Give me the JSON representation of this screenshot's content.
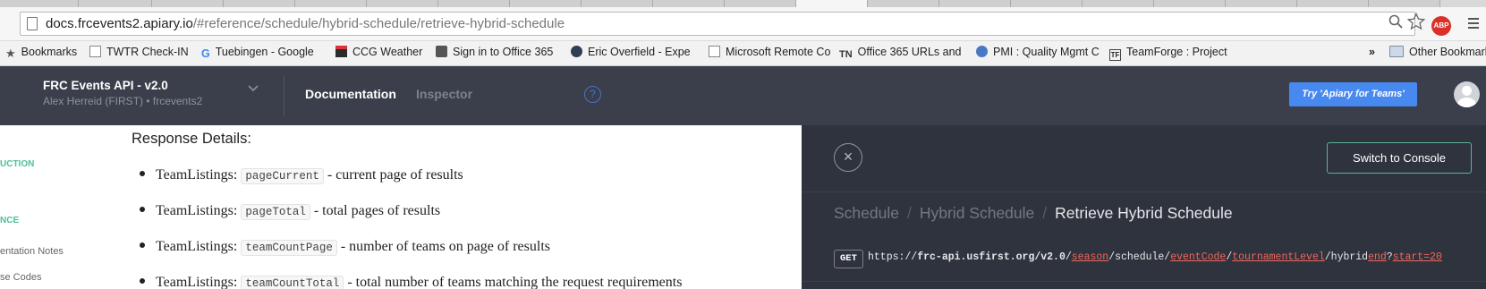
{
  "browser": {
    "url_host": "docs.frcevents2.apiary.io",
    "url_path": "/#reference/schedule/hybrid-schedule/retrieve-hybrid-schedule",
    "abp_label": "ABP"
  },
  "bookmarks": [
    {
      "label": "Bookmarks",
      "icon": "star-icon"
    },
    {
      "label": "TWTR Check-IN",
      "icon": "page-icon"
    },
    {
      "label": "Tuebingen - Google",
      "icon": "google-icon"
    },
    {
      "label": "CCG Weather",
      "icon": "weather-icon"
    },
    {
      "label": "Sign in to Office 365",
      "icon": "office-icon"
    },
    {
      "label": "Eric Overfield - Expe",
      "icon": "profile-icon"
    },
    {
      "label": "Microsoft Remote Co",
      "icon": "page-icon"
    },
    {
      "label": "Office 365 URLs and",
      "icon": "tn-icon"
    },
    {
      "label": "PMI : Quality Mgmt C",
      "icon": "globe-icon"
    },
    {
      "label": "TeamForge : Project",
      "icon": "teamforge-icon"
    },
    {
      "label": "»",
      "icon": ""
    },
    {
      "label": "Other Bookmarks",
      "icon": "folder-icon"
    }
  ],
  "appbar": {
    "title": "FRC Events API - v2.0",
    "subtitle": "Alex Herreid (FIRST) • frcevents2",
    "nav_documentation": "Documentation",
    "nav_inspector": "Inspector",
    "help": "?",
    "try_button": "Try 'Apiary for Teams'"
  },
  "sidebar": {
    "items": [
      "UCTION",
      "NCE",
      "entation Notes",
      "se Codes"
    ]
  },
  "content": {
    "heading": "Response Details:",
    "bullets": [
      {
        "prefix": "TeamListings:",
        "code": "pageCurrent",
        "desc": "- current page of results"
      },
      {
        "prefix": "TeamListings:",
        "code": "pageTotal",
        "desc": "- total pages of results"
      },
      {
        "prefix": "TeamListings:",
        "code": "teamCountPage",
        "desc": "- number of teams on page of results"
      },
      {
        "prefix": "TeamListings:",
        "code": "teamCountTotal",
        "desc": "- total number of teams matching the request requirements"
      }
    ]
  },
  "panel": {
    "close": "×",
    "console_button": "Switch to Console",
    "crumbs": [
      "Schedule",
      "Hybrid Schedule",
      "Retrieve Hybrid Schedule"
    ],
    "crumb_sep": "/",
    "method": "GET",
    "endpoint": {
      "prefix": "https://",
      "host": "frc-api.usfirst.org/v2.0",
      "s1": "/",
      "p1": "season",
      "s2": "/schedule/",
      "p2": "eventCode",
      "s3": "/",
      "p3": "tournamentLevel",
      "s4": "/hybrid",
      "p4": "end",
      "s5": "?",
      "p5": "start=20"
    }
  }
}
